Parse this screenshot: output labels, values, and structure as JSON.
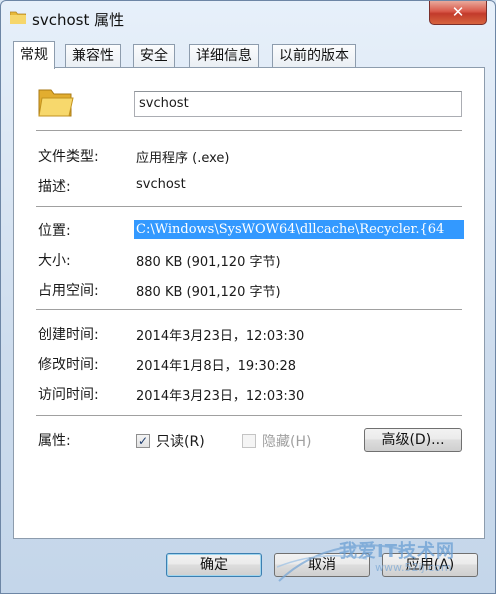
{
  "window": {
    "title": "svchost 属性",
    "close_symbol": "✕"
  },
  "tabs": [
    {
      "label": "常规",
      "active": true
    },
    {
      "label": "兼容性",
      "active": false
    },
    {
      "label": "安全",
      "active": false
    },
    {
      "label": "详细信息",
      "active": false
    },
    {
      "label": "以前的版本",
      "active": false
    }
  ],
  "general": {
    "file_name": "svchost",
    "rows": {
      "type_label": "文件类型:",
      "type_value": "应用程序 (.exe)",
      "desc_label": "描述:",
      "desc_value": "svchost",
      "location_label": "位置:",
      "location_value": "C:\\Windows\\SysWOW64\\dllcache\\Recycler.{64",
      "size_label": "大小:",
      "size_value": "880 KB (901,120 字节)",
      "disk_label": "占用空间:",
      "disk_value": "880 KB (901,120 字节)",
      "created_label": "创建时间:",
      "created_value": "2014年3月23日，12:03:30",
      "modified_label": "修改时间:",
      "modified_value": "2014年1月8日，19:30:28",
      "accessed_label": "访问时间:",
      "accessed_value": "2014年3月23日，12:03:30",
      "attributes_label": "属性:"
    },
    "readonly": {
      "label": "只读(R)",
      "checked": true,
      "mark": "✓"
    },
    "hidden": {
      "label": "隐藏(H)",
      "checked": false,
      "enabled": false
    },
    "advanced_label": "高级(D)..."
  },
  "buttons": {
    "ok": "确定",
    "cancel": "取消",
    "apply": "应用(A)"
  },
  "watermark": {
    "line1": "我爱IT技术网",
    "line2": "www.52ij.com"
  },
  "colors": {
    "selection": "#3399ff",
    "close_red": "#c23a2b",
    "folder_yellow": "#f2c84b"
  }
}
